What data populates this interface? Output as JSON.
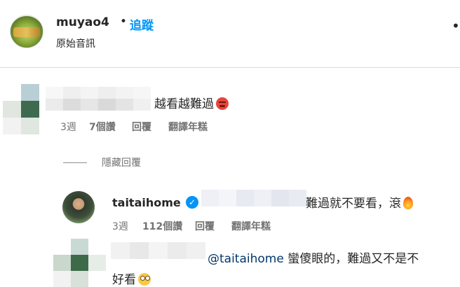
{
  "post": {
    "username": "muyao4",
    "dot": "•",
    "follow_label": "追蹤",
    "audio_label": "原始音訊",
    "more_label": "•"
  },
  "comments": [
    {
      "text": "越看越難過",
      "emoji": "angry-face-icon",
      "time": "3週",
      "likes": "7個讚",
      "reply_label": "回覆",
      "translate_label": "翻譯年糕",
      "mosaic_avatar": [
        "#ffffff",
        "#b9cfd6",
        "#dfe7df",
        "#3e6b50",
        "#f2f2f2",
        "#e0e6e0"
      ],
      "mosaic_name": [
        "#f7f7f7",
        "#efefef",
        "#f4f4f4",
        "#eeeeee",
        "#f3f3f3",
        "#f6f6f6",
        "#ebebeb",
        "#dcdcdc",
        "#e6e6e6",
        "#d9d9d9",
        "#e4e4e4",
        "#f0f0f0"
      ]
    }
  ],
  "hide_replies_label": "隱藏回覆",
  "replies": [
    {
      "username": "taitaihome",
      "verified": true,
      "text": "難過就不要看，滾",
      "emoji": "fire-icon",
      "time": "3週",
      "likes": "112個讚",
      "reply_label": "回覆",
      "translate_label": "翻譯年糕",
      "mosaic_name": [
        "#eef0f6",
        "#f4f5f8",
        "#e7eaf1",
        "#eef0f6",
        "#e3e6ee",
        "#e9ebf2"
      ]
    },
    {
      "mention": "@taitaihome",
      "text_line1": " 蠻傻眼的，難過又不是不",
      "text_line2": "好看",
      "emoji": "eye-roll-icon",
      "mosaic_avatar": [
        "#ffffff",
        "#c8dad3",
        "#ffffff",
        "#c9d7cc",
        "#3d6b4a",
        "#e6ece6",
        "#f2f2f2",
        "#d7e0d9",
        "#ffffff"
      ],
      "mosaic_name": [
        "#f1f1f1",
        "#e8e8e8",
        "#f4f4f4",
        "#ebebeb",
        "#f0f0f0"
      ]
    }
  ],
  "colors": {
    "link_blue": "#0095f6",
    "meta_gray": "#737373",
    "text": "#262626"
  }
}
